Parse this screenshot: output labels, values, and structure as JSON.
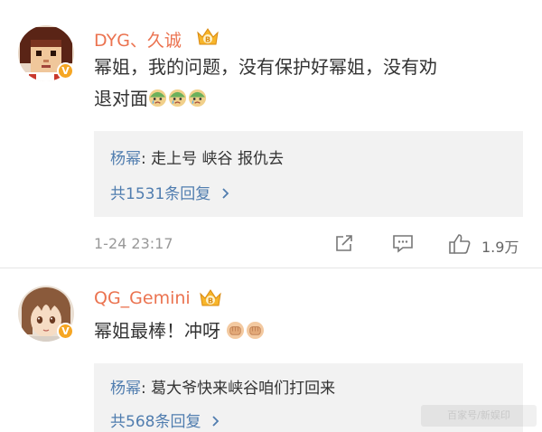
{
  "comments": [
    {
      "username": "DYG、久诚",
      "text_line1": "幂姐，我的问题，没有保护好幂姐，没有劝",
      "text_line2": "退对面",
      "emoji_icon": "sad-cry-emoji",
      "emoji_count": 3,
      "reply": {
        "name": "杨幂",
        "text": ": 走上号 峡谷 报仇去"
      },
      "more_replies": "共1531条回复",
      "time": "1-24 23:17",
      "likes": "1.9万"
    },
    {
      "username": "QG_Gemini",
      "text": "幂姐最棒！冲呀",
      "emoji_icon": "fist-emoji",
      "emoji_count": 2,
      "reply": {
        "name": "杨幂",
        "text": ": 葛大爷快来峡谷咱们打回来"
      },
      "more_replies": "共568条回复"
    }
  ],
  "icons": {
    "verified": "verified-badge-icon",
    "crown": "vip-crown-icon",
    "share": "share-icon",
    "comment": "comment-icon",
    "like": "like-icon",
    "chevron": "chevron-right-icon"
  },
  "colors": {
    "username": "#eb7350",
    "link": "#507daf",
    "reply_bg": "#f2f2f2",
    "badge": "#f6a623",
    "meta": "#999999"
  },
  "badge_glyph": "V",
  "watermark": "百家号/新娱印"
}
